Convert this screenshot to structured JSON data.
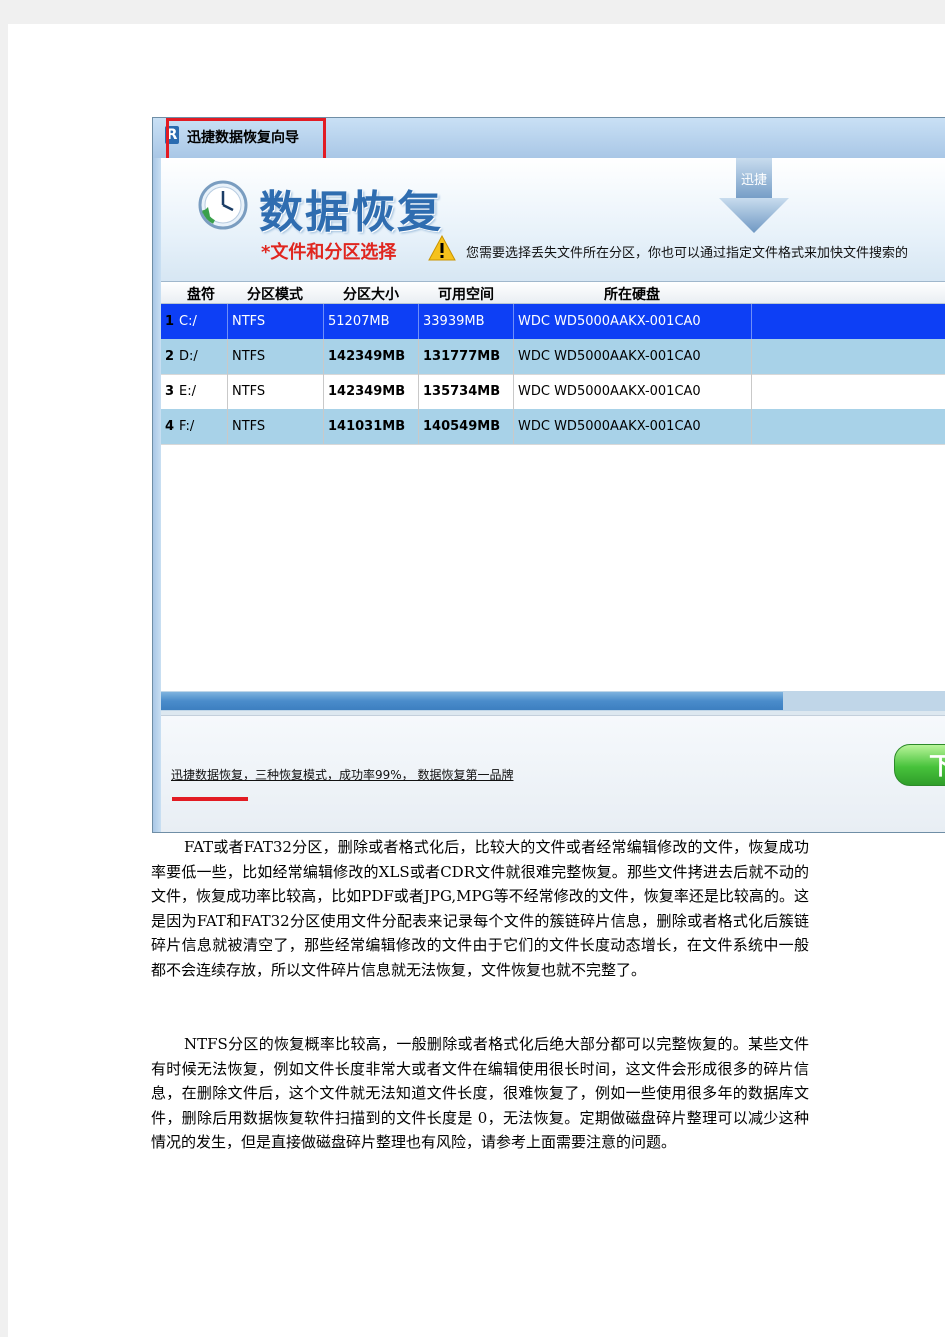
{
  "app": {
    "title": "迅捷数据恢复向导",
    "logo": "R",
    "banner_title": "数据恢复",
    "arrow_label": "迅捷",
    "step_label": "*文件和分区选择",
    "tip": "您需要选择丢失文件所在分区，你也可以通过指定文件格式来加快文件搜索的",
    "columns": [
      "盘符",
      "分区模式",
      "分区大小",
      "可用空间",
      "所在硬盘"
    ],
    "rows": [
      {
        "num": "1",
        "drive": "C:/",
        "mode": "NTFS",
        "size": "51207MB",
        "free": "33939MB",
        "disk": "WDC WD5000AAKX-001CA0"
      },
      {
        "num": "2",
        "drive": "D:/",
        "mode": "NTFS",
        "size": "142349MB",
        "free": "131777MB",
        "disk": "WDC WD5000AAKX-001CA0"
      },
      {
        "num": "3",
        "drive": "E:/",
        "mode": "NTFS",
        "size": "142349MB",
        "free": "135734MB",
        "disk": "WDC WD5000AAKX-001CA0"
      },
      {
        "num": "4",
        "drive": "F:/",
        "mode": "NTFS",
        "size": "141031MB",
        "free": "140549MB",
        "disk": "WDC WD5000AAKX-001CA0"
      }
    ],
    "slogan": "迅捷数据恢复，三种恢复模式，成功率99%， 数据恢复第一品牌",
    "next_label": "下"
  },
  "article": {
    "para1": "FAT或者FAT32分区，删除或者格式化后，比较大的文件或者经常编辑修改的文件，恢复成功率要低一些，比如经常编辑修改的XLS或者CDR文件就很难完整恢复。那些文件拷进去后就不动的文件，恢复成功率比较高，比如PDF或者JPG,MPG等不经常修改的文件，恢复率还是比较高的。这是因为FAT和FAT32分区使用文件分配表来记录每个文件的簇链碎片信息，删除或者格式化后簇链碎片信息就被清空了，那些经常编辑修改的文件由于它们的文件长度动态增长，在文件系统中一般都不会连续存放，所以文件碎片信息就无法恢复，文件恢复也就不完整了。",
    "para2": "NTFS分区的恢复概率比较高，一般删除或者格式化后绝大部分都可以完整恢复的。某些文件有时候无法恢复，例如文件长度非常大或者文件在编辑使用很长时间，这文件会形成很多的碎片信息，在删除文件后，这个文件就无法知道文件长度，很难恢复了，例如一些使用很多年的数据库文件，删除后用数据恢复软件扫描到的文件长度是 0，无法恢复。定期做磁盘碎片整理可以减少这种情况的发生，但是直接做磁盘碎片整理也有风险，请参考上面需要注意的问题。"
  },
  "colors": {
    "highlight_red": "#e21b23",
    "selected_row": "#0d3ff5",
    "alt_row": "#a8d2e8",
    "banner_blue": "#2f6db0"
  }
}
